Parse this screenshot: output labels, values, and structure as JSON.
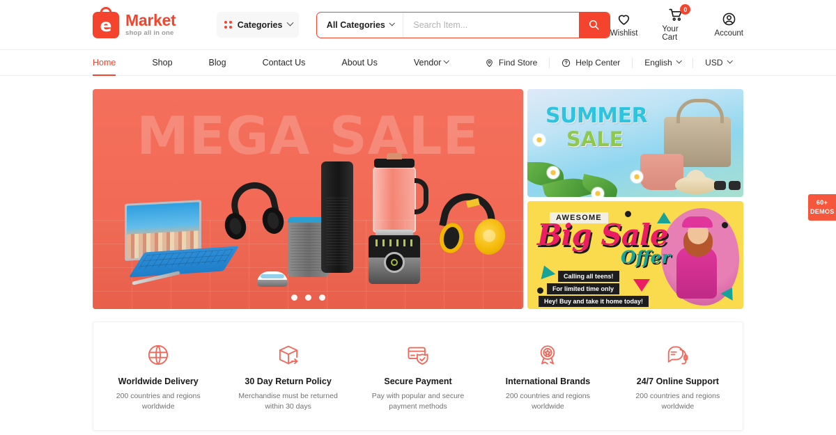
{
  "header": {
    "logo": {
      "letter": "e",
      "title": "Market",
      "tagline": "shop all in one"
    },
    "categories_button": {
      "label": "Categories",
      "icon": "grid-dots-icon",
      "chevron": "chevron-down-icon"
    },
    "search": {
      "category_label": "All Categories",
      "placeholder": "Search Item...",
      "value": "",
      "button_icon": "search-icon"
    },
    "actions": [
      {
        "label": "Wishlist",
        "icon": "heart-icon",
        "badge": null
      },
      {
        "label": "Your Cart",
        "icon": "cart-icon",
        "badge": "0"
      },
      {
        "label": "Account",
        "icon": "user-circle-icon",
        "badge": null
      }
    ]
  },
  "nav": {
    "items": [
      {
        "label": "Home",
        "active": true,
        "has_chevron": false
      },
      {
        "label": "Shop",
        "active": false,
        "has_chevron": false
      },
      {
        "label": "Blog",
        "active": false,
        "has_chevron": false
      },
      {
        "label": "Contact Us",
        "active": false,
        "has_chevron": false
      },
      {
        "label": "About Us",
        "active": false,
        "has_chevron": false
      },
      {
        "label": "Vendor",
        "active": false,
        "has_chevron": true
      }
    ],
    "utilities": [
      {
        "label": "Find Store",
        "icon": "map-pin-icon",
        "has_chevron": false
      },
      {
        "label": "Help Center",
        "icon": "question-circle-icon",
        "has_chevron": false
      },
      {
        "label": "English",
        "icon": null,
        "has_chevron": true
      },
      {
        "label": "USD",
        "icon": null,
        "has_chevron": true
      }
    ]
  },
  "hero": {
    "main_banner": {
      "headline": "MEGA SALE",
      "background_color": "#F4705C",
      "pagination_dots": 3,
      "active_dot_index": 0
    },
    "summer_banner": {
      "line1": "SUMMER",
      "line2": "SALE",
      "line1_color": "#2FC4DE",
      "line2_color": "#8FC84F"
    },
    "big_sale_banner": {
      "eyebrow": "AWESOME",
      "title": "Big Sale",
      "subtitle": "Offer",
      "background_color": "#F9DB4D",
      "title_color": "#EC1E63",
      "subtitle_color": "#17A398",
      "taglines": [
        "Calling all teens!",
        "For limited time only",
        "Hey! Buy and take it home today!"
      ]
    }
  },
  "features": [
    {
      "icon": "globe-icon",
      "title": "Worldwide Delivery",
      "description": "200 countries and regions worldwide"
    },
    {
      "icon": "return-box-icon",
      "title": "30 Day Return Policy",
      "description": "Merchandise must be returned within 30 days"
    },
    {
      "icon": "card-shield-icon",
      "title": "Secure Payment",
      "description": "Pay with popular and secure payment methods"
    },
    {
      "icon": "award-ribbon-icon",
      "title": "International Brands",
      "description": "200 countries and regions worldwide"
    },
    {
      "icon": "headset-support-icon",
      "title": "24/7 Online Support",
      "description": "200 countries and regions worldwide"
    }
  ],
  "demos_tab": {
    "line1": "60+",
    "line2": "DEMOS",
    "color": "#F4573C"
  },
  "theme": {
    "brand_red": "#F4442E",
    "hero_coral": "#F4705C",
    "yellow": "#F9DB4D"
  }
}
